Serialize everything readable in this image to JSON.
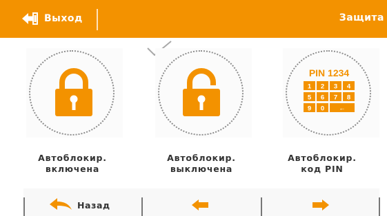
{
  "header": {
    "exit_label": "Выход",
    "title": "Защита"
  },
  "options": [
    {
      "line1": "Автоблокир.",
      "line2": "включена",
      "icon": "lock-closed-icon",
      "selected": false
    },
    {
      "line1": "Автоблокир.",
      "line2": "выключена",
      "icon": "lock-open-icon",
      "selected": true
    },
    {
      "line1": "Автоблокир.",
      "line2": "код PIN",
      "icon": "pin-keypad-icon",
      "selected": false
    }
  ],
  "pin": {
    "title": "PIN 1234",
    "keys": [
      "1",
      "2",
      "3",
      "4",
      "5",
      "6",
      "7",
      "8",
      "9",
      "0",
      "←"
    ]
  },
  "footer": {
    "back_label": "Назад"
  },
  "colors": {
    "accent": "#f39200",
    "text": "#333333"
  }
}
